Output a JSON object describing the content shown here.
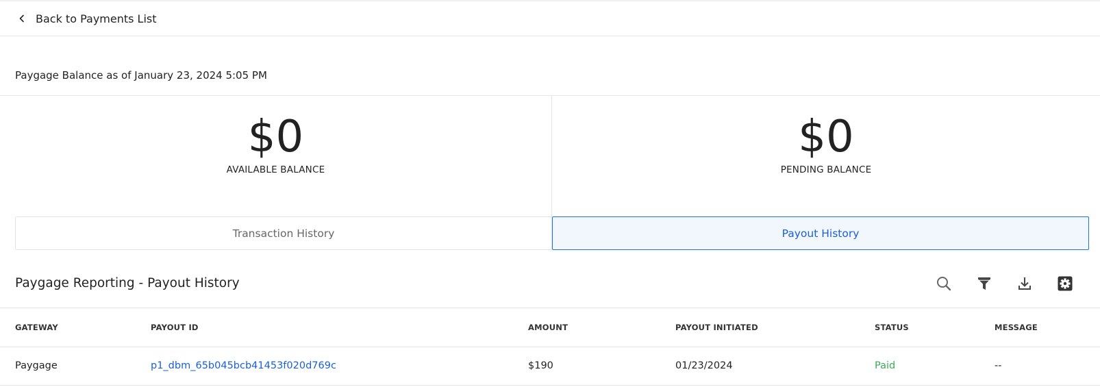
{
  "header": {
    "back_label": "Back to Payments List"
  },
  "balance": {
    "title": "Paygage Balance as of January 23, 2024 5:05 PM",
    "available": {
      "amount": "$0",
      "label": "AVAILABLE BALANCE"
    },
    "pending": {
      "amount": "$0",
      "label": "PENDING BALANCE"
    }
  },
  "tabs": [
    {
      "label": "Transaction History",
      "active": false
    },
    {
      "label": "Payout History",
      "active": true
    }
  ],
  "report": {
    "title": "Paygage Reporting - Payout History",
    "toolbar": {
      "search_icon": "search-icon",
      "filter_icon": "filter-icon",
      "download_icon": "download-icon",
      "settings_icon": "gear-icon"
    }
  },
  "table": {
    "columns": [
      "GATEWAY",
      "PAYOUT ID",
      "AMOUNT",
      "PAYOUT INITIATED",
      "STATUS",
      "MESSAGE"
    ],
    "rows": [
      {
        "gateway": "Paygage",
        "payout_id": "p1_dbm_65b045bcb41453f020d769c",
        "amount": "$190",
        "payout_initiated": "01/23/2024",
        "status": "Paid",
        "message": "--"
      }
    ]
  },
  "colors": {
    "accent": "#1a5fd8",
    "accent_border": "#1a73e8",
    "active_tab_bg": "#f2f7fd",
    "status_paid": "#3daa56"
  }
}
